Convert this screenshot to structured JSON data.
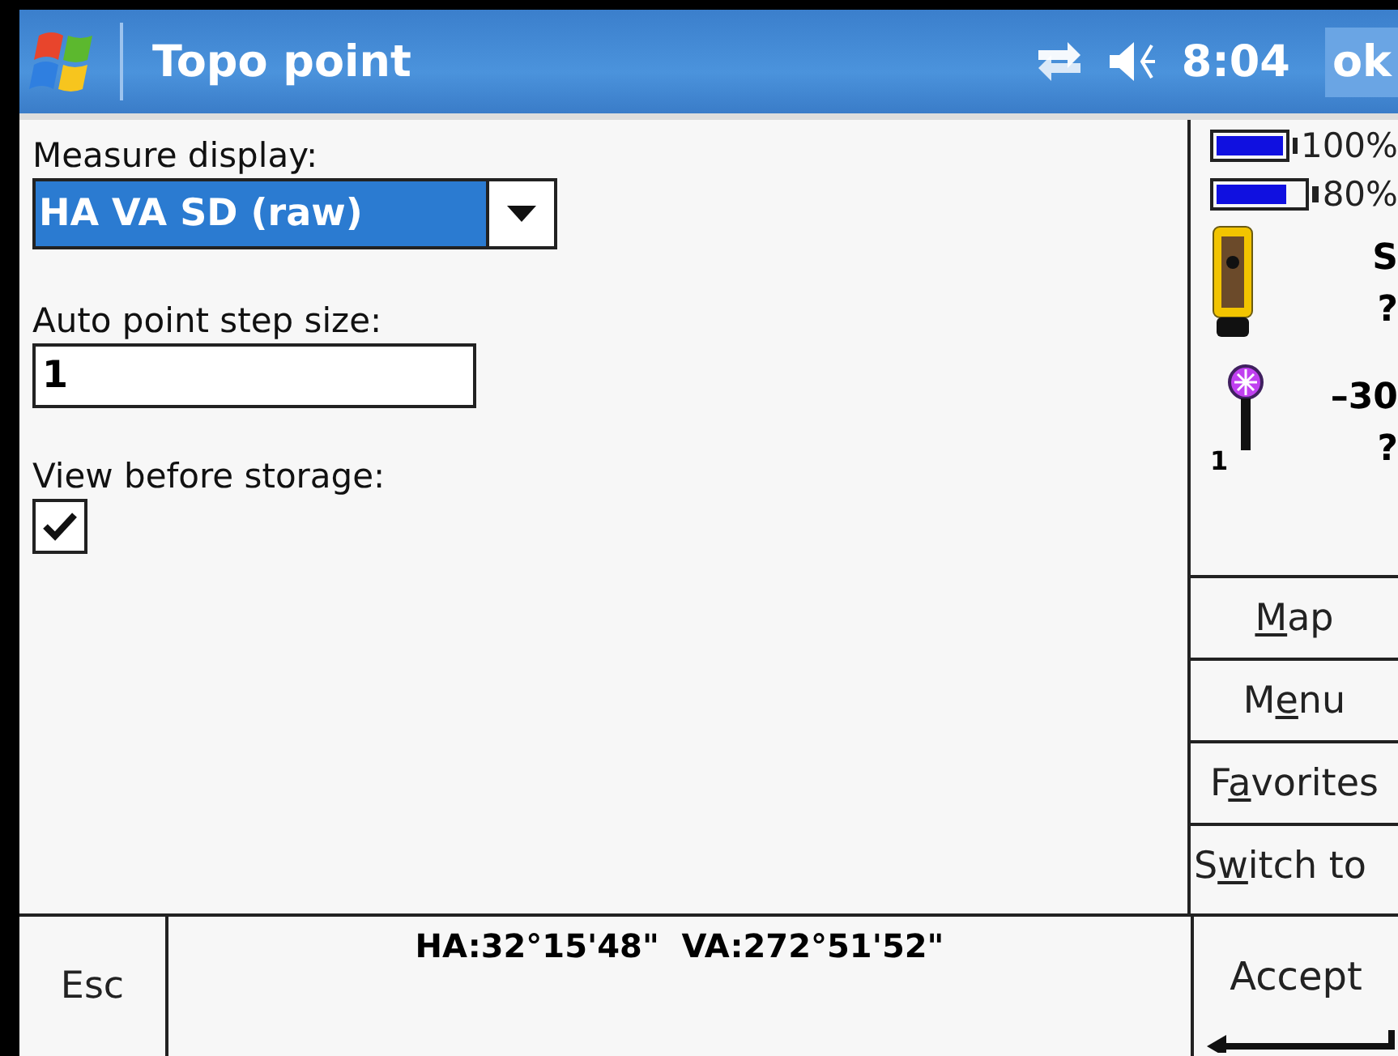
{
  "title_bar": {
    "title": "Topo point",
    "time": "8:04",
    "ok": "ok"
  },
  "form": {
    "measure_display": {
      "label": "Measure display:",
      "value": "HA VA SD (raw)"
    },
    "step_size": {
      "label": "Auto point step size:",
      "value": "1"
    },
    "view_before_storage": {
      "label": "View before storage:",
      "checked": true
    }
  },
  "status_panel": {
    "batteries": [
      {
        "level": 1.0,
        "reading": "100%"
      },
      {
        "level": 0.8,
        "reading": "80%"
      }
    ],
    "instrument": {
      "line_1": "S",
      "line_2": "?"
    },
    "target": {
      "number": "1",
      "line_1": "–30",
      "line_2": "?"
    }
  },
  "side_buttons": [
    {
      "key": "M",
      "post": "ap"
    },
    {
      "pre": "M",
      "key": "e",
      "post": "nu"
    },
    {
      "pre": "F",
      "key": "a",
      "post": "vorites"
    },
    {
      "pre": "S",
      "key": "w",
      "post": "itch to"
    }
  ],
  "bottom_bar": {
    "esc": "Esc",
    "readout": "HA:32°15'48\"  VA:272°51'52\"",
    "accept": "Accept"
  }
}
